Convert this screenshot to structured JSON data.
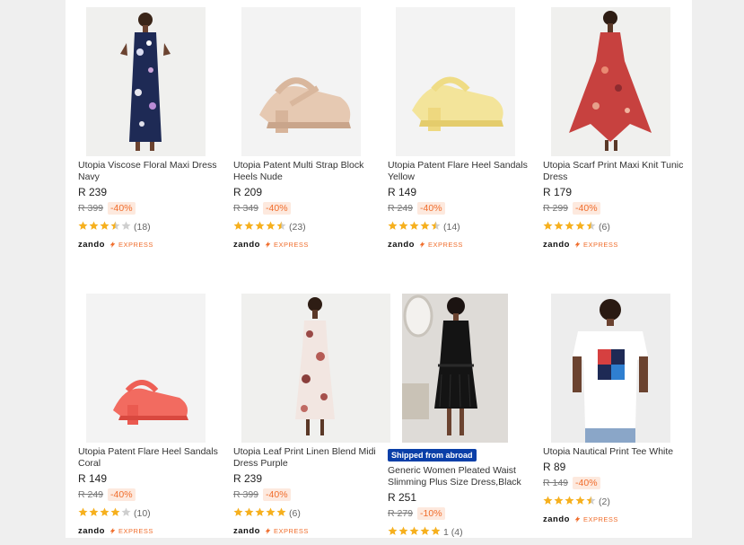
{
  "products": [
    {
      "title": "Utopia Viscose Floral Maxi Dress Navy",
      "price": "R 239",
      "old_price": "R 399",
      "discount": "-40%",
      "rating": 3.5,
      "reviews": "(18)",
      "brand": "zando",
      "shipping": "EXPRESS",
      "image": "floral-maxi-dress-navy"
    },
    {
      "title": "Utopia Patent Multi Strap Block Heels Nude",
      "price": "R 209",
      "old_price": "R 349",
      "discount": "-40%",
      "rating": 4.5,
      "reviews": "(23)",
      "brand": "zando",
      "shipping": "EXPRESS",
      "image": "nude-block-heel"
    },
    {
      "title": "Utopia Patent Flare Heel Sandals Yellow",
      "price": "R 149",
      "old_price": "R 249",
      "discount": "-40%",
      "rating": 4.5,
      "reviews": "(14)",
      "brand": "zando",
      "shipping": "EXPRESS",
      "image": "yellow-sandal"
    },
    {
      "title": "Utopia Scarf Print Maxi Knit Tunic Dress",
      "price": "R 179",
      "old_price": "R 299",
      "discount": "-40%",
      "rating": 4.5,
      "reviews": "(6)",
      "brand": "zando",
      "shipping": "EXPRESS",
      "image": "red-scarf-dress"
    },
    {
      "title": "Utopia Patent Flare Heel Sandals Coral",
      "price": "R 149",
      "old_price": "R 249",
      "discount": "-40%",
      "rating": 4.0,
      "reviews": "(10)",
      "brand": "zando",
      "shipping": "EXPRESS",
      "image": "coral-sandal"
    },
    {
      "title": "Utopia Leaf Print Linen Blend Midi Dress Purple",
      "price": "R 239",
      "old_price": "R 399",
      "discount": "-40%",
      "rating": 5.0,
      "reviews": "(6)",
      "brand": "zando",
      "shipping": "EXPRESS",
      "image": "leaf-print-dress"
    },
    {
      "badge": "Shipped from abroad",
      "title": "Generic Women Pleated Waist Slimming Plus Size Dress,Black",
      "price": "R 251",
      "old_price": "R 279",
      "discount": "-10%",
      "rating": 5.0,
      "reviews": "1 (4)",
      "image": "black-pleated-dress"
    },
    {
      "title": "Utopia Nautical Print Tee White",
      "price": "R 89",
      "old_price": "R 149",
      "discount": "-40%",
      "rating": 4.5,
      "reviews": "(2)",
      "brand": "zando",
      "shipping": "EXPRESS",
      "image": "white-tee"
    }
  ],
  "colors": {
    "star": "#f6b01e",
    "star_empty": "#cfcfcf",
    "discount_text": "#f06e2d",
    "discount_bg": "#fde9de",
    "badge_bg": "#0a3fa8"
  }
}
